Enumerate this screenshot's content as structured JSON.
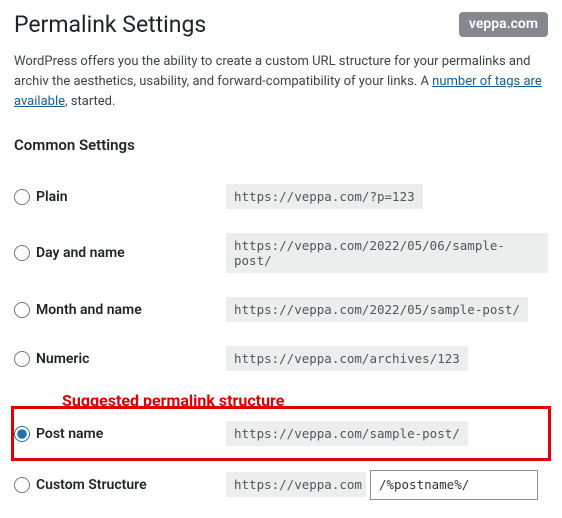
{
  "badge": "veppa.com",
  "page_title": "Permalink Settings",
  "intro": {
    "before_link": "WordPress offers you the ability to create a custom URL structure for your permalinks and archiv the aesthetics, usability, and forward-compatibility of your links. A ",
    "link_text": "number of tags are available",
    "after_link": ", started."
  },
  "section_title": "Common Settings",
  "annotation": "Suggested permalink structure",
  "options": {
    "plain": {
      "label": "Plain",
      "example": "https://veppa.com/?p=123"
    },
    "dayname": {
      "label": "Day and name",
      "example": "https://veppa.com/2022/05/06/sample-post/"
    },
    "monthname": {
      "label": "Month and name",
      "example": "https://veppa.com/2022/05/sample-post/"
    },
    "numeric": {
      "label": "Numeric",
      "example": "https://veppa.com/archives/123"
    },
    "postname": {
      "label": "Post name",
      "example": "https://veppa.com/sample-post/"
    },
    "custom": {
      "label": "Custom Structure",
      "prefix": "https://veppa.com",
      "value": "/%postname%/"
    }
  }
}
